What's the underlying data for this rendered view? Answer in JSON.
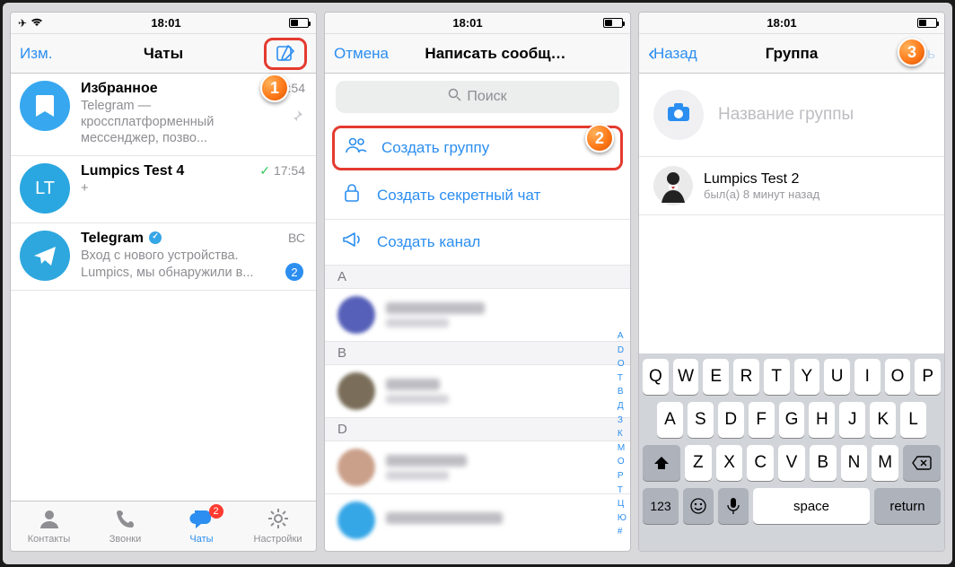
{
  "statusbar": {
    "time": "18:01"
  },
  "screen1": {
    "nav": {
      "edit": "Изм.",
      "title": "Чаты"
    },
    "chats": [
      {
        "name": "Избранное",
        "msg": "Telegram — кроссплатформенный мессенджер, позво...",
        "time": "17:54"
      },
      {
        "name": "Lumpics Test 4",
        "msg": "+",
        "time": "17:54"
      },
      {
        "name": "Telegram",
        "msg": "Вход с нового устройства. Lumpics, мы обнаружили в...",
        "time": "ВС",
        "unread": "2"
      }
    ],
    "avatar_lt": "LT",
    "tabs": {
      "contacts": "Контакты",
      "calls": "Звонки",
      "chats": "Чаты",
      "settings": "Настройки",
      "badge": "2"
    }
  },
  "screen2": {
    "cancel": "Отмена",
    "title": "Написать сообщ…",
    "search": "Поиск",
    "menu": {
      "group": "Создать группу",
      "secret": "Создать секретный чат",
      "channel": "Создать канал"
    },
    "sections": [
      "A",
      "B",
      "D"
    ],
    "index": [
      "A",
      "D",
      "O",
      "T",
      "B",
      "Д",
      "З",
      "К",
      "М",
      "О",
      "Р",
      "Т",
      "Ц",
      "Ю",
      "#"
    ]
  },
  "screen3": {
    "back": "Назад",
    "title": "Группа",
    "action": "дать",
    "placeholder": "Название группы",
    "member": {
      "name": "Lumpics Test 2",
      "status": "был(а) 8 минут назад"
    },
    "keyboard": {
      "r1": [
        "Q",
        "W",
        "E",
        "R",
        "T",
        "Y",
        "U",
        "I",
        "O",
        "P"
      ],
      "r2": [
        "A",
        "S",
        "D",
        "F",
        "G",
        "H",
        "J",
        "K",
        "L"
      ],
      "r3": [
        "Z",
        "X",
        "C",
        "V",
        "B",
        "N",
        "M"
      ],
      "num": "123",
      "space": "space",
      "return": "return"
    }
  },
  "callouts": {
    "one": "1",
    "two": "2",
    "three": "3"
  }
}
